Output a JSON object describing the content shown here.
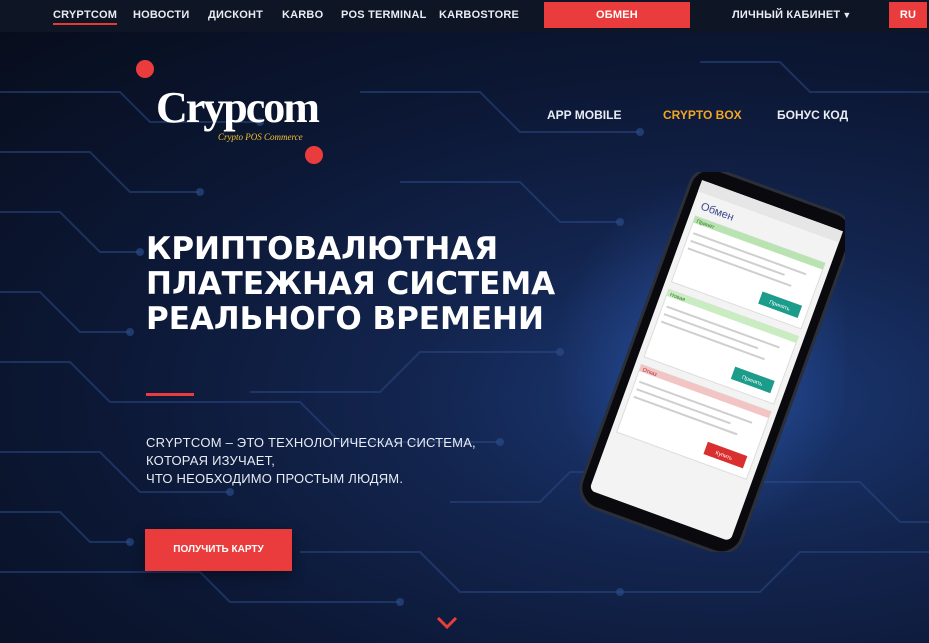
{
  "topnav": {
    "items": [
      {
        "label": "CRYPTCOM",
        "active": true
      },
      {
        "label": "НОВОСТИ"
      },
      {
        "label": "ДИСКОНТ"
      },
      {
        "label": "KARBO"
      },
      {
        "label": "POS TERMINAL"
      },
      {
        "label": "KARBOSTORE"
      }
    ],
    "exchange_label": "ОБМЕН",
    "cabinet_label": "ЛИЧНЫЙ КАБИНЕТ",
    "lang_label": "RU"
  },
  "logo": {
    "word": "Crypcom",
    "tagline": "Crypto POS Commerce"
  },
  "subnav": {
    "items": [
      {
        "label": "APP MOBILE"
      },
      {
        "label": "CRYPTO BOX",
        "highlight": true
      },
      {
        "label": "БОНУС КОД"
      }
    ]
  },
  "hero": {
    "headline_lines": [
      "КРИПТОВАЛЮТНАЯ",
      "ПЛАТЕЖНАЯ СИСТЕМА",
      "РЕАЛЬНОГО ВРЕМЕНИ"
    ],
    "description_lines": [
      "CRYPTCOM –  ЭТО ТЕХНОЛОГИЧЕСКАЯ СИСТЕМА,",
      "КОТОРАЯ ИЗУЧАЕТ,",
      "ЧТО НЕОБХОДИМО ПРОСТЫМ ЛЮДЯМ."
    ],
    "cta_label": "ПОЛУЧИТЬ КАРТУ"
  },
  "phone_screen": {
    "title": "Обмен",
    "cards": [
      {
        "status": "Принят",
        "button": "Принять"
      },
      {
        "status": "Новая",
        "button": "Принять"
      },
      {
        "status": "Отказ",
        "button": "Купить"
      }
    ]
  },
  "colors": {
    "accent": "#ea3c3c",
    "highlight": "#f2a623",
    "background": "#0b1220"
  }
}
